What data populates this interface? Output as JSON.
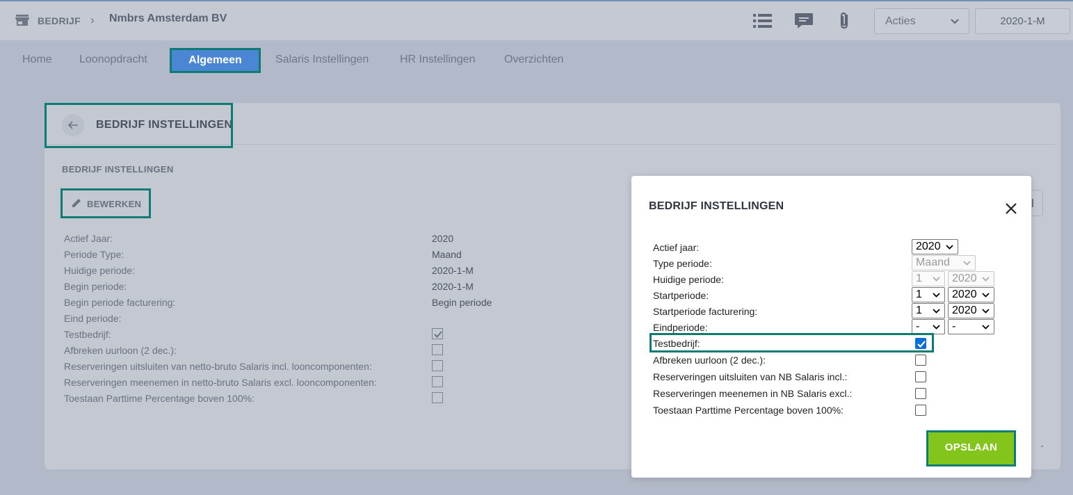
{
  "breadcrumb": {
    "company_label": "BEDRIJF",
    "separator": "›",
    "company_name": "Nmbrs Amsterdam BV"
  },
  "toolbar": {
    "actions_label": "Acties",
    "period_label": "2020-1-M",
    "icons": [
      "store-icon",
      "list-icon",
      "chat-icon",
      "paperclip-icon",
      "chevron-down-icon"
    ]
  },
  "nav": {
    "tabs": [
      "Home",
      "Loonopdracht",
      "Algemeen",
      "Salaris Instellingen",
      "HR Instellingen",
      "Overzichten"
    ],
    "active": "Algemeen"
  },
  "colors": {
    "accent": "#4a86d4",
    "highlight_frame": "#0e7c74",
    "save_button": "#84c51b",
    "checkbox_checked": "#0b6fd8"
  },
  "panel": {
    "title": "BEDRIJF INSTELLINGEN",
    "section_title": "BEDRIJF INSTELLINGEN",
    "edit_label": "BEWERKEN",
    "rows": [
      {
        "label": "Actief Jaar:",
        "value": "2020"
      },
      {
        "label": "Periode Type:",
        "value": "Maand"
      },
      {
        "label": "Huidige periode:",
        "value": "2020-1-M"
      },
      {
        "label": "Begin periode:",
        "value": "2020-1-M"
      },
      {
        "label": "Begin periode facturering:",
        "value": "Begin periode"
      },
      {
        "label": "Eind periode:",
        "value": ""
      },
      {
        "label": "Testbedrijf:",
        "checked": true
      },
      {
        "label": "Afbreken uurloon (2 dec.):",
        "checked": false
      },
      {
        "label": "Reserveringen uitsluiten van netto-bruto Salaris incl. looncomponenten:",
        "checked": false
      },
      {
        "label": "Reserveringen meenemen in netto-bruto Salaris excl. looncomponenten:",
        "checked": false
      },
      {
        "label": "Toestaan Parttime Percentage boven 100%:",
        "checked": false
      }
    ]
  },
  "modal": {
    "title": "BEDRIJF INSTELLINGEN",
    "close_symbol": "×",
    "labels": {
      "actief_jaar": "Actief jaar:",
      "type_periode": "Type periode:",
      "huidige_periode": "Huidige periode:",
      "startperiode": "Startperiode:",
      "startperiode_facturering": "Startperiode facturering:",
      "eindperiode": "Eindperiode:",
      "testbedrijf": "Testbedrijf:",
      "afbreken": "Afbreken uurloon (2 dec.):",
      "res_uitsluiten": "Reserveringen uitsluiten van NB Salaris incl.:",
      "res_meenemen": "Reserveringen meenemen in NB Salaris excl.:",
      "parttime": "Toestaan Parttime Percentage boven 100%:"
    },
    "selects": {
      "actief_jaar": "2020",
      "type_periode": "Maand",
      "huidige_periode_nr": "1",
      "huidige_periode_jaar": "2020",
      "startperiode_nr": "1",
      "startperiode_jaar": "2020",
      "start_fact_nr": "1",
      "start_fact_jaar": "2020",
      "eind_nr": "-",
      "eind_jaar": "-"
    },
    "checks": {
      "testbedrijf": true,
      "afbreken": false,
      "res_uitsluiten": false,
      "res_meenemen": false,
      "parttime": false
    },
    "save_label": "OPSLAAN"
  }
}
